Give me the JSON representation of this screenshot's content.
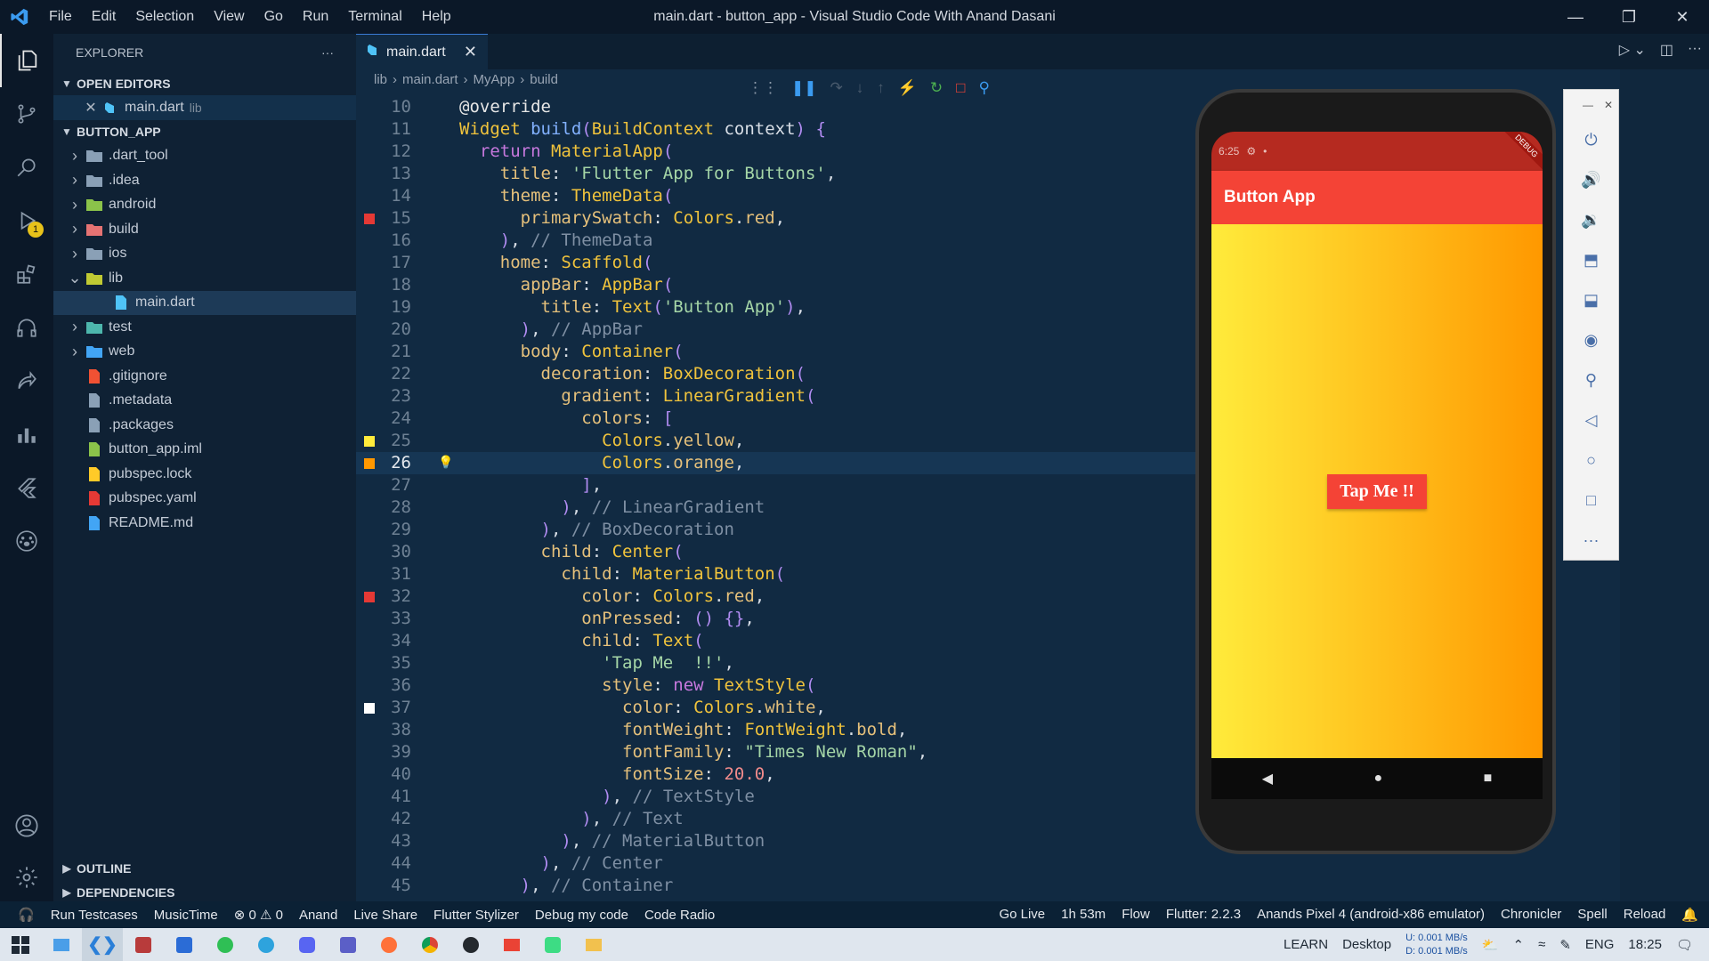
{
  "titlebar": {
    "menu": [
      "File",
      "Edit",
      "Selection",
      "View",
      "Go",
      "Run",
      "Terminal",
      "Help"
    ],
    "title": "main.dart - button_app - Visual Studio Code With Anand Dasani"
  },
  "activity": {
    "run_badge": "1"
  },
  "sidebar": {
    "title": "EXPLORER",
    "more": "···",
    "open_editors_label": "OPEN EDITORS",
    "open_editor": {
      "name": "main.dart",
      "folder": "lib"
    },
    "project_label": "BUTTON_APP",
    "tree": [
      {
        "name": ".dart_tool",
        "kind": "folder",
        "color": "#8aa0b6"
      },
      {
        "name": ".idea",
        "kind": "folder",
        "color": "#8aa0b6"
      },
      {
        "name": "android",
        "kind": "folder",
        "color": "#8bc34a"
      },
      {
        "name": "build",
        "kind": "folder",
        "color": "#e57373"
      },
      {
        "name": "ios",
        "kind": "folder",
        "color": "#8aa0b6"
      },
      {
        "name": "lib",
        "kind": "folder-open",
        "color": "#c0ca33"
      },
      {
        "name": "main.dart",
        "kind": "dart",
        "color": "#4fc3f7"
      },
      {
        "name": "test",
        "kind": "folder",
        "color": "#4db6ac"
      },
      {
        "name": "web",
        "kind": "folder",
        "color": "#42a5f5"
      },
      {
        "name": ".gitignore",
        "kind": "git",
        "color": "#f05133"
      },
      {
        "name": ".metadata",
        "kind": "file",
        "color": "#8aa0b6"
      },
      {
        "name": ".packages",
        "kind": "file",
        "color": "#8aa0b6"
      },
      {
        "name": "button_app.iml",
        "kind": "file",
        "color": "#8bc34a"
      },
      {
        "name": "pubspec.lock",
        "kind": "lock",
        "color": "#ffca28"
      },
      {
        "name": "pubspec.yaml",
        "kind": "yaml",
        "color": "#e53935"
      },
      {
        "name": "README.md",
        "kind": "info",
        "color": "#42a5f5"
      }
    ],
    "outline_label": "OUTLINE",
    "dependencies_label": "DEPENDENCIES"
  },
  "editor": {
    "tab": "main.dart",
    "breadcrumb": [
      "lib",
      "main.dart",
      "MyApp",
      "build"
    ],
    "current_line": "26",
    "lines": [
      {
        "n": "10",
        "h": "<span class=\"at\">@override</span>"
      },
      {
        "n": "11",
        "h": "<span class=\"ty\">Widget</span> <span class=\"fn\">build</span><span class=\"pn\">(</span><span class=\"ty\">BuildContext</span> context<span class=\"pn\">)</span> <span class=\"pn\">{</span>"
      },
      {
        "n": "12",
        "h": "  <span class=\"kw\">return</span> <span class=\"ty\">MaterialApp</span><span class=\"pn\">(</span>"
      },
      {
        "n": "13",
        "h": "    <span class=\"pr\">title</span>: <span class=\"st\">'Flutter App for Buttons'</span>,"
      },
      {
        "n": "14",
        "h": "    <span class=\"pr\">theme</span>: <span class=\"ty\">ThemeData</span><span class=\"pn\">(</span>"
      },
      {
        "n": "15",
        "h": "      <span class=\"pr\">primarySwatch</span>: <span class=\"ty\">Colors</span>.<span class=\"pr\">red</span>,",
        "m": "#e53935"
      },
      {
        "n": "16",
        "h": "    <span class=\"pn\">)</span>, <span class=\"cm\">// ThemeData</span>"
      },
      {
        "n": "17",
        "h": "    <span class=\"pr\">home</span>: <span class=\"ty\">Scaffold</span><span class=\"pn\">(</span>"
      },
      {
        "n": "18",
        "h": "      <span class=\"pr\">appBar</span>: <span class=\"ty\">AppBar</span><span class=\"pn\">(</span>"
      },
      {
        "n": "19",
        "h": "        <span class=\"pr\">title</span>: <span class=\"ty\">Text</span><span class=\"pn\">(</span><span class=\"st\">'Button App'</span><span class=\"pn\">)</span>,"
      },
      {
        "n": "20",
        "h": "      <span class=\"pn\">)</span>, <span class=\"cm\">// AppBar</span>"
      },
      {
        "n": "21",
        "h": "      <span class=\"pr\">body</span>: <span class=\"ty\">Container</span><span class=\"pn\">(</span>"
      },
      {
        "n": "22",
        "h": "        <span class=\"pr\">decoration</span>: <span class=\"ty\">BoxDecoration</span><span class=\"pn\">(</span>"
      },
      {
        "n": "23",
        "h": "          <span class=\"pr\">gradient</span>: <span class=\"ty\">LinearGradient</span><span class=\"pn\">(</span>"
      },
      {
        "n": "24",
        "h": "            <span class=\"pr\">colors</span>: <span class=\"pn\">[</span>"
      },
      {
        "n": "25",
        "h": "              <span class=\"ty\">Colors</span>.<span class=\"pr\">yellow</span>,",
        "m": "#ffeb3b"
      },
      {
        "n": "26",
        "h": "              <span class=\"ty\">Colors</span>.<span class=\"pr\">orange</span>,",
        "m": "#ff9800"
      },
      {
        "n": "27",
        "h": "            <span class=\"pn\">]</span>,"
      },
      {
        "n": "28",
        "h": "          <span class=\"pn\">)</span>, <span class=\"cm\">// LinearGradient</span>"
      },
      {
        "n": "29",
        "h": "        <span class=\"pn\">)</span>, <span class=\"cm\">// BoxDecoration</span>"
      },
      {
        "n": "30",
        "h": "        <span class=\"pr\">child</span>: <span class=\"ty\">Center</span><span class=\"pn\">(</span>"
      },
      {
        "n": "31",
        "h": "          <span class=\"pr\">child</span>: <span class=\"ty\">MaterialButton</span><span class=\"pn\">(</span>"
      },
      {
        "n": "32",
        "h": "            <span class=\"pr\">color</span>: <span class=\"ty\">Colors</span>.<span class=\"pr\">red</span>,",
        "m": "#e53935"
      },
      {
        "n": "33",
        "h": "            <span class=\"pr\">onPressed</span>: <span class=\"pn\">()</span> <span class=\"pn\">{}</span>,"
      },
      {
        "n": "34",
        "h": "            <span class=\"pr\">child</span>: <span class=\"ty\">Text</span><span class=\"pn\">(</span>"
      },
      {
        "n": "35",
        "h": "              <span class=\"st\">'Tap Me  !!'</span>,"
      },
      {
        "n": "36",
        "h": "              <span class=\"pr\">style</span>: <span class=\"kw\">new</span> <span class=\"ty\">TextStyle</span><span class=\"pn\">(</span>"
      },
      {
        "n": "37",
        "h": "                <span class=\"pr\">color</span>: <span class=\"ty\">Colors</span>.<span class=\"pr\">white</span>,",
        "m": "#ffffff"
      },
      {
        "n": "38",
        "h": "                <span class=\"pr\">fontWeight</span>: <span class=\"ty\">FontWeight</span>.<span class=\"pr\">bold</span>,"
      },
      {
        "n": "39",
        "h": "                <span class=\"pr\">fontFamily</span>: <span class=\"st\">\"Times New Roman\"</span>,"
      },
      {
        "n": "40",
        "h": "                <span class=\"pr\">fontSize</span>: <span class=\"nm\">20.0</span>,"
      },
      {
        "n": "41",
        "h": "              <span class=\"pn\">)</span>, <span class=\"cm\">// TextStyle</span>"
      },
      {
        "n": "42",
        "h": "            <span class=\"pn\">)</span>, <span class=\"cm\">// Text</span>"
      },
      {
        "n": "43",
        "h": "          <span class=\"pn\">)</span>, <span class=\"cm\">// MaterialButton</span>"
      },
      {
        "n": "44",
        "h": "        <span class=\"pn\">)</span>, <span class=\"cm\">// Center</span>"
      },
      {
        "n": "45",
        "h": "      <span class=\"pn\">)</span>, <span class=\"cm\">// Container</span>"
      }
    ]
  },
  "phone": {
    "time": "6:25",
    "debug_ribbon": "DEBUG",
    "appbar_title": "Button App",
    "button_label": "Tap Me !!"
  },
  "statusbar": {
    "items": [
      "Run Testcases",
      "MusicTime",
      "⊗ 0 ⚠ 0",
      "Anand",
      "Live Share",
      "Flutter Stylizer",
      "Debug my code",
      "Code Radio"
    ],
    "right": [
      "Go Live",
      "1h 53m",
      "Flow",
      "Flutter: 2.2.3",
      "Anands Pixel 4 (android-x86 emulator)",
      "Chronicler",
      "Spell",
      "Reload"
    ]
  },
  "taskbar": {
    "learn": "LEARN",
    "desktop": "Desktop",
    "net_up_label": "U:",
    "net_up": "0.001 MB/s",
    "net_down_label": "D:",
    "net_down": "0.001 MB/s",
    "lang": "ENG",
    "time": "18:25"
  }
}
